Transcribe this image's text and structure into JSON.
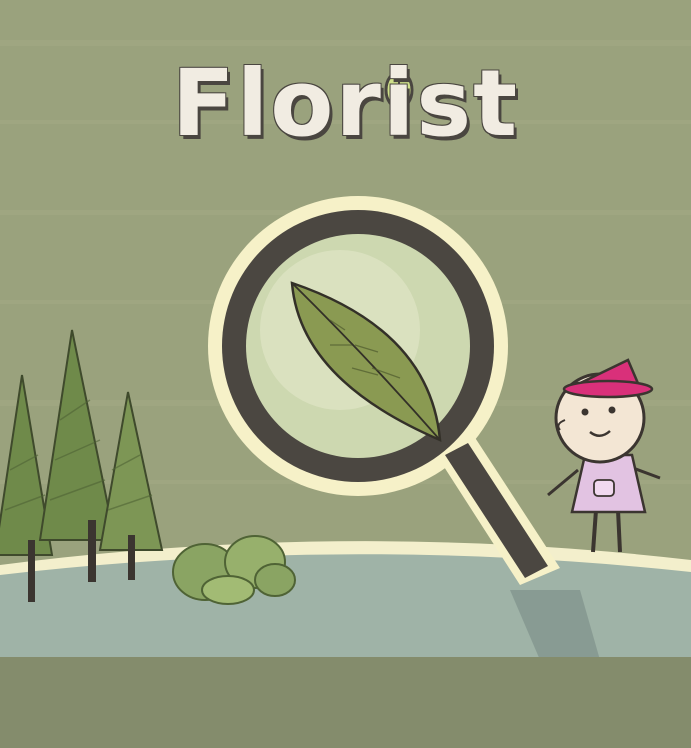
{
  "game": {
    "title": "Florist"
  },
  "colors": {
    "sky": "#9aa27d",
    "ground": "#9fb3a7",
    "bottom_band": "#848c6c",
    "title_fill": "#f1ece2",
    "title_outline": "#4a4640",
    "lens_frame": "#4b4741",
    "lens_glow": "#f6f1c8",
    "leaf": "#8a9a52",
    "tree": "#6f8a4a",
    "hat": "#d9307a",
    "dress": "#e2c3e2"
  },
  "icons": {
    "title_leaf": "leaf-icon",
    "magnifier": "magnifying-glass-icon"
  }
}
